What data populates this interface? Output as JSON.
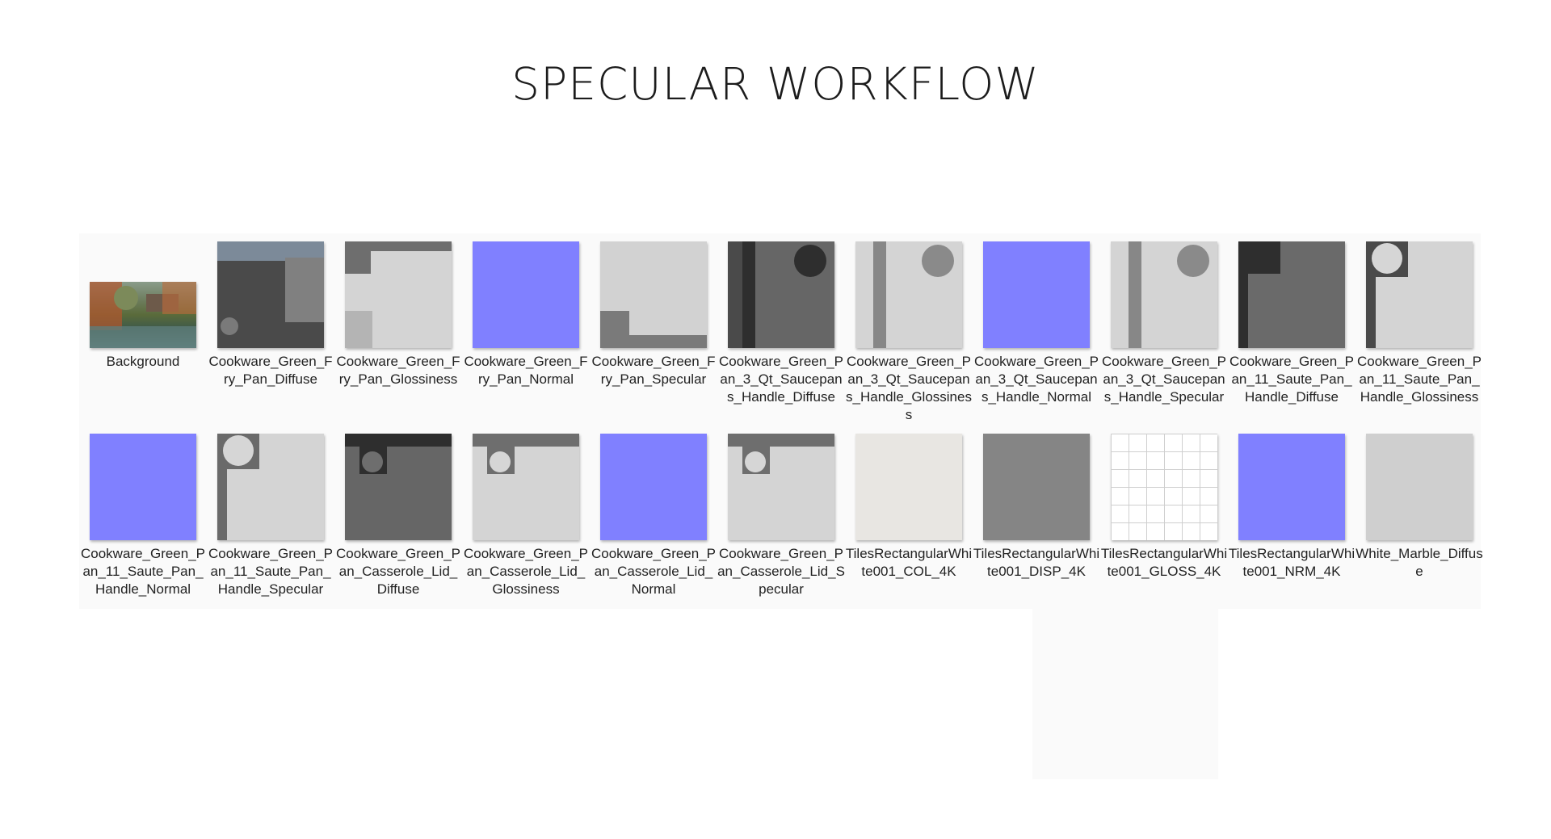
{
  "title": "SPECULAR WORKFLOW",
  "files": [
    {
      "name": "Background",
      "thumbnail": "photo-thumbnail"
    },
    {
      "name": "Cookware_Green_Fry_Pan_Diffuse",
      "thumbnail": "texture-thumbnail"
    },
    {
      "name": "Cookware_Green_Fry_Pan_Glossiness",
      "thumbnail": "texture-thumbnail"
    },
    {
      "name": "Cookware_Green_Fry_Pan_Normal",
      "thumbnail": "texture-thumbnail"
    },
    {
      "name": "Cookware_Green_Fry_Pan_Specular",
      "thumbnail": "texture-thumbnail"
    },
    {
      "name": "Cookware_Green_Pan_3_Qt_Saucepans_Handle_Diffuse",
      "thumbnail": "texture-thumbnail"
    },
    {
      "name": "Cookware_Green_Pan_3_Qt_Saucepans_Handle_Glossiness",
      "thumbnail": "texture-thumbnail"
    },
    {
      "name": "Cookware_Green_Pan_3_Qt_Saucepans_Handle_Normal",
      "thumbnail": "texture-thumbnail"
    },
    {
      "name": "Cookware_Green_Pan_3_Qt_Saucepans_Handle_Specular",
      "thumbnail": "texture-thumbnail"
    },
    {
      "name": "Cookware_Green_Pan_11_Saute_Pan_Handle_Diffuse",
      "thumbnail": "texture-thumbnail"
    },
    {
      "name": "Cookware_Green_Pan_11_Saute_Pan_Handle_Glossiness",
      "thumbnail": "texture-thumbnail"
    },
    {
      "name": "Cookware_Green_Pan_11_Saute_Pan_Handle_Normal",
      "thumbnail": "texture-thumbnail"
    },
    {
      "name": "Cookware_Green_Pan_11_Saute_Pan_Handle_Specular",
      "thumbnail": "texture-thumbnail"
    },
    {
      "name": "Cookware_Green_Pan_Casserole_Lid_Diffuse",
      "thumbnail": "texture-thumbnail"
    },
    {
      "name": "Cookware_Green_Pan_Casserole_Lid_Glossiness",
      "thumbnail": "texture-thumbnail"
    },
    {
      "name": "Cookware_Green_Pan_Casserole_Lid_Normal",
      "thumbnail": "texture-thumbnail"
    },
    {
      "name": "Cookware_Green_Pan_Casserole_Lid_Specular",
      "thumbnail": "texture-thumbnail"
    },
    {
      "name": "TilesRectangularWhite001_COL_4K",
      "thumbnail": "texture-thumbnail"
    },
    {
      "name": "TilesRectangularWhite001_DISP_4K",
      "thumbnail": "texture-thumbnail"
    },
    {
      "name": "TilesRectangularWhite001_GLOSS_4K",
      "thumbnail": "texture-thumbnail"
    },
    {
      "name": "TilesRectangularWhite001_NRM_4K",
      "thumbnail": "texture-thumbnail"
    },
    {
      "name": "White_Marble_Diffuse",
      "thumbnail": "texture-thumbnail"
    }
  ]
}
